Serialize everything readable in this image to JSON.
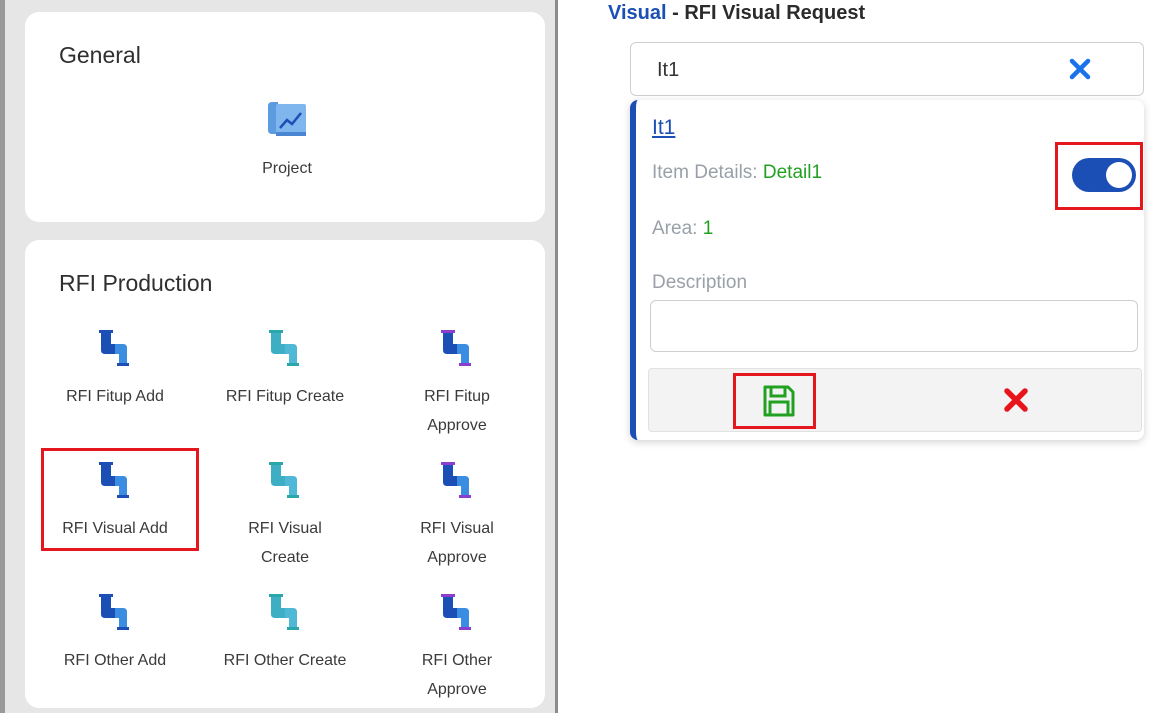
{
  "left": {
    "general": {
      "title": "General",
      "items": [
        {
          "label": "Project",
          "icon": "project-chart-icon"
        }
      ]
    },
    "rfi_production": {
      "title": "RFI Production",
      "items": [
        {
          "label": "RFI Fitup Add",
          "icon": "pipe-icon-add"
        },
        {
          "label": "RFI Fitup Create",
          "icon": "pipe-icon-create"
        },
        {
          "label": "RFI Fitup Approve",
          "icon": "pipe-icon-approve"
        },
        {
          "label": "RFI Visual Add",
          "icon": "pipe-icon-add",
          "highlighted": true
        },
        {
          "label": "RFI Visual Create",
          "icon": "pipe-icon-create"
        },
        {
          "label": "RFI Visual Approve",
          "icon": "pipe-icon-approve"
        },
        {
          "label": "RFI Other Add",
          "icon": "pipe-icon-add"
        },
        {
          "label": "RFI Other Create",
          "icon": "pipe-icon-create"
        },
        {
          "label": "RFI Other Approve",
          "icon": "pipe-icon-approve"
        }
      ]
    }
  },
  "right": {
    "title_link": "Visual",
    "title_rest": " - RFI Visual Request",
    "search": {
      "value": "It1",
      "clear_icon": "close-icon"
    },
    "item": {
      "name": "It1",
      "details_label": "Item Details: ",
      "details_value": "Detail1",
      "area_label": "Area: ",
      "area_value": "1",
      "description_label": "Description",
      "description_value": "",
      "toggle_on": true
    }
  },
  "colors": {
    "accent": "#1c4fb5",
    "success": "#22a022",
    "danger": "#e4161e",
    "panel_bg": "#e6e6e6"
  }
}
